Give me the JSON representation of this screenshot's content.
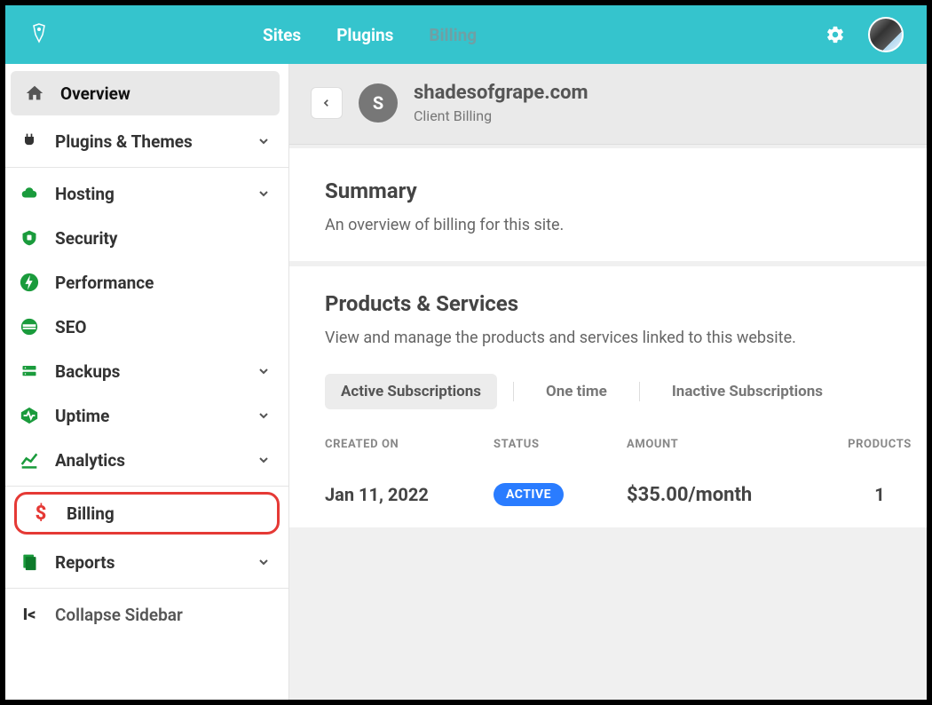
{
  "topnav": {
    "items": [
      {
        "label": "Sites",
        "dim": false
      },
      {
        "label": "Plugins",
        "dim": false
      },
      {
        "label": "Billing",
        "dim": true
      }
    ]
  },
  "sidebar": {
    "overview": "Overview",
    "plugins_themes": "Plugins & Themes",
    "hosting": "Hosting",
    "security": "Security",
    "performance": "Performance",
    "seo": "SEO",
    "backups": "Backups",
    "uptime": "Uptime",
    "analytics": "Analytics",
    "billing": "Billing",
    "reports": "Reports",
    "collapse": "Collapse Sidebar"
  },
  "header": {
    "badge_letter": "S",
    "site_name": "shadesofgrape.com",
    "subtitle": "Client Billing"
  },
  "summary": {
    "title": "Summary",
    "desc": "An overview of billing for this site."
  },
  "products": {
    "title": "Products & Services",
    "desc": "View and manage the products and services linked to this website.",
    "tabs": {
      "active_subs": "Active Subscriptions",
      "one_time": "One time",
      "inactive_subs": "Inactive Subscriptions"
    },
    "columns": {
      "created": "CREATED ON",
      "status": "STATUS",
      "amount": "AMOUNT",
      "products": "PRODUCTS"
    },
    "rows": [
      {
        "created": "Jan 11, 2022",
        "status": "ACTIVE",
        "amount": "$35.00/month",
        "products": "1"
      }
    ]
  }
}
